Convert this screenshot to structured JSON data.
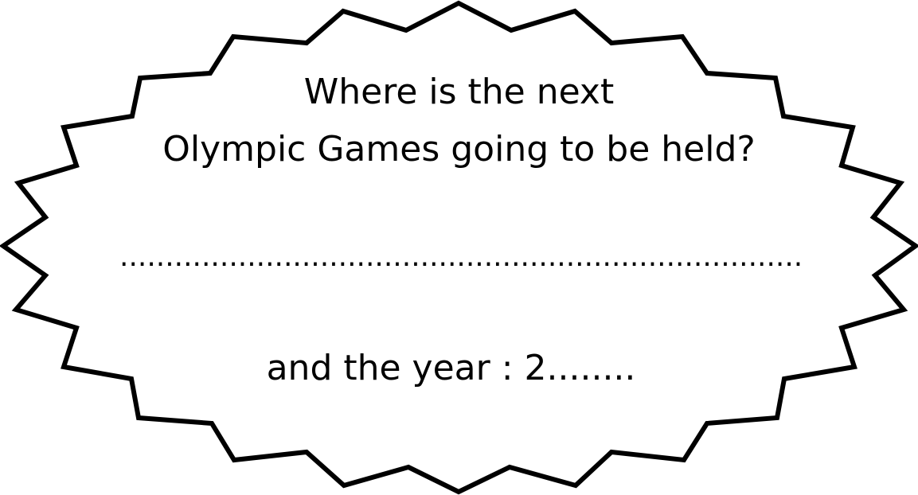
{
  "question": {
    "line1": "Where is the next",
    "line2": "Olympic Games going to be held?"
  },
  "answer_line": "......................................................................................",
  "year_prompt": "and the year : 2........",
  "colors": {
    "outline": "#000000",
    "background": "#ffffff",
    "text": "#000000"
  }
}
